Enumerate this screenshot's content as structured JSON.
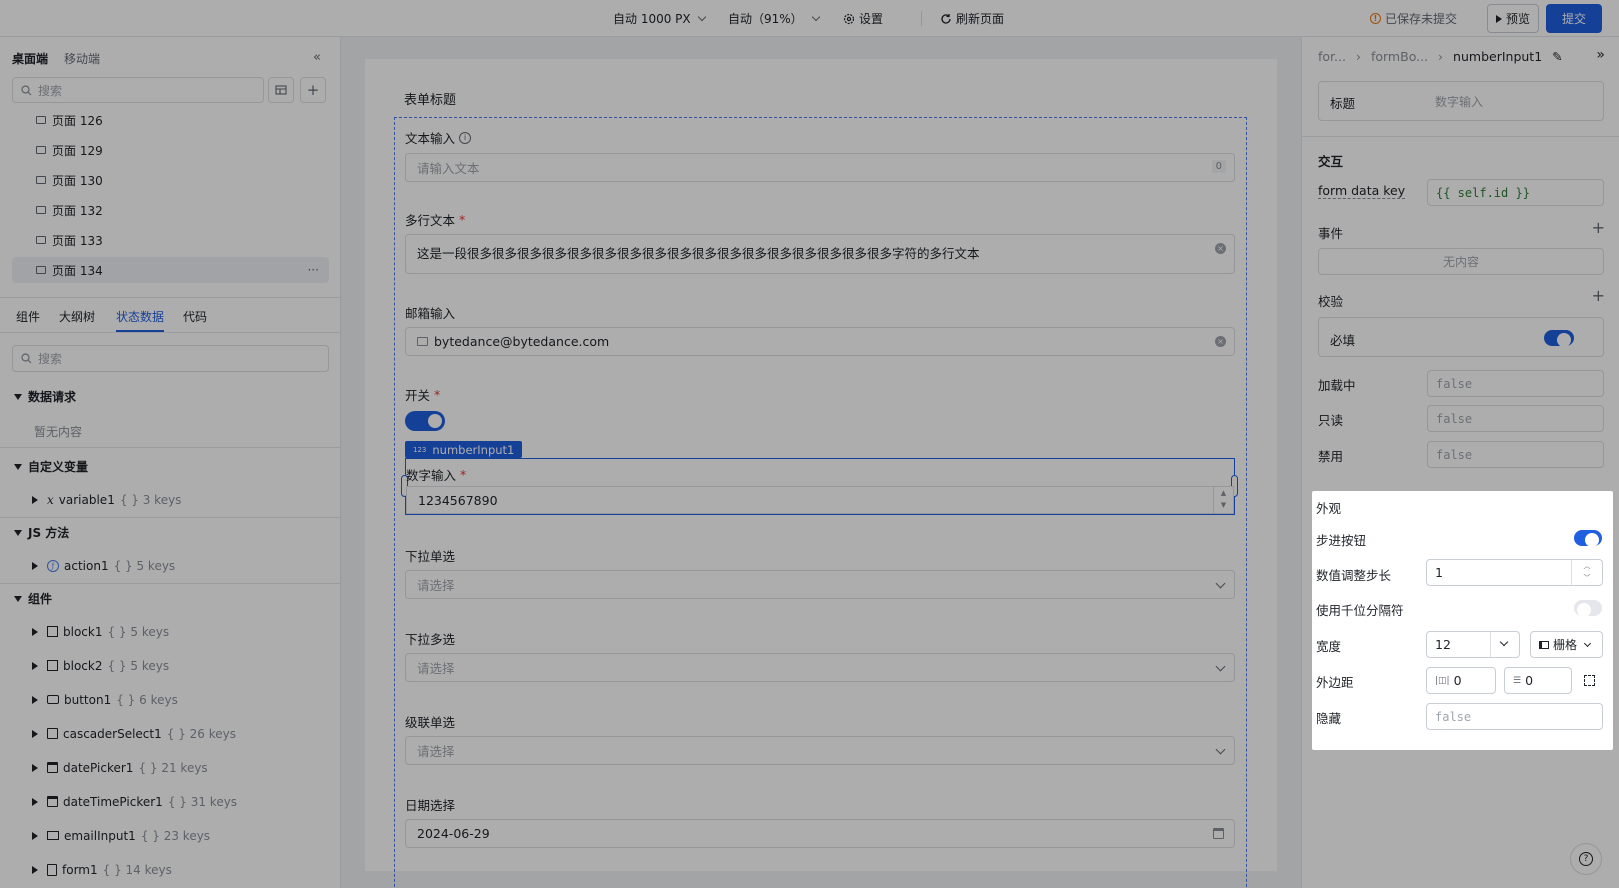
{
  "topbar": {
    "width_mode": "自动 1000 PX",
    "zoom_mode": "自动（91%）",
    "settings": "设置",
    "refresh": "刷新页面",
    "saved_status": "已保存未提交",
    "preview": "预览",
    "submit": "提交"
  },
  "left": {
    "tabs": [
      "桌面端",
      "移动端"
    ],
    "search_placeholder": "搜索",
    "pages": [
      "页面 126",
      "页面 129",
      "页面 130",
      "页面 132",
      "页面 133",
      "页面 134"
    ],
    "more": "···",
    "bottom_tabs": [
      "组件",
      "大纲树",
      "状态数据",
      "代码"
    ],
    "state_search_placeholder": "搜索",
    "sections": {
      "data_request": "数据请求",
      "data_request_empty": "暂无内容",
      "custom_vars": "自定义变量",
      "js_methods": "JS 方法",
      "components": "组件"
    },
    "variables": [
      {
        "name": "variable1",
        "keys": "{ } 3 keys"
      }
    ],
    "actions": [
      {
        "name": "action1",
        "keys": "{ } 5 keys"
      }
    ],
    "components": [
      {
        "name": "block1",
        "keys": "{ } 5 keys"
      },
      {
        "name": "block2",
        "keys": "{ } 5 keys"
      },
      {
        "name": "button1",
        "keys": "{ } 6 keys"
      },
      {
        "name": "cascaderSelect1",
        "keys": "{ } 26 keys"
      },
      {
        "name": "datePicker1",
        "keys": "{ } 21 keys"
      },
      {
        "name": "dateTimePicker1",
        "keys": "{ } 31 keys"
      },
      {
        "name": "emailInput1",
        "keys": "{ } 23 keys"
      },
      {
        "name": "form1",
        "keys": "{ } 14 keys"
      }
    ]
  },
  "form": {
    "title": "表单标题",
    "text_label": "文本输入",
    "text_placeholder": "请输入文本",
    "text_count": "0",
    "textarea_label": "多行文本",
    "textarea_value": "这是一段很多很多很多很多很多很多很多很多很多很多很多很多很多很多很多很多很多字符的多行文本",
    "email_label": "邮箱输入",
    "email_value": "bytedance@bytedance.com",
    "switch_label": "开关",
    "component_tag": "numberInput1",
    "number_label": "数字输入",
    "number_value": "1234567890",
    "select_label": "下拉单选",
    "select_placeholder": "请选择",
    "multi_label": "下拉多选",
    "multi_placeholder": "请选择",
    "cascader_label": "级联单选",
    "cascader_placeholder": "请选择",
    "date_label": "日期选择",
    "date_value": "2024-06-29",
    "required_mark": "*"
  },
  "right": {
    "breadcrumb": [
      "for...",
      "formBo...",
      "numberInput1"
    ],
    "title_label": "标题",
    "title_value": "数字输入",
    "interaction": "交互",
    "form_data_key_label": "form data key",
    "form_data_key_value": "{{ self.id }}",
    "events": "事件",
    "events_empty": "无内容",
    "validation": "校验",
    "required": "必填",
    "loading": "加载中",
    "readonly": "只读",
    "disabled": "禁用",
    "false_value": "false",
    "appearance": "外观",
    "stepper": "步进按钮",
    "step": "数值调整步长",
    "step_value": "1",
    "thousands": "使用千位分隔符",
    "width": "宽度",
    "width_value": "12",
    "width_unit": "栅格",
    "margin": "外边距",
    "margin_h": "0",
    "margin_v": "0",
    "hidden": "隐藏",
    "hidden_value": "false"
  },
  "colors": {
    "primary": "#1f5fe0",
    "warning": "#e8740c"
  }
}
